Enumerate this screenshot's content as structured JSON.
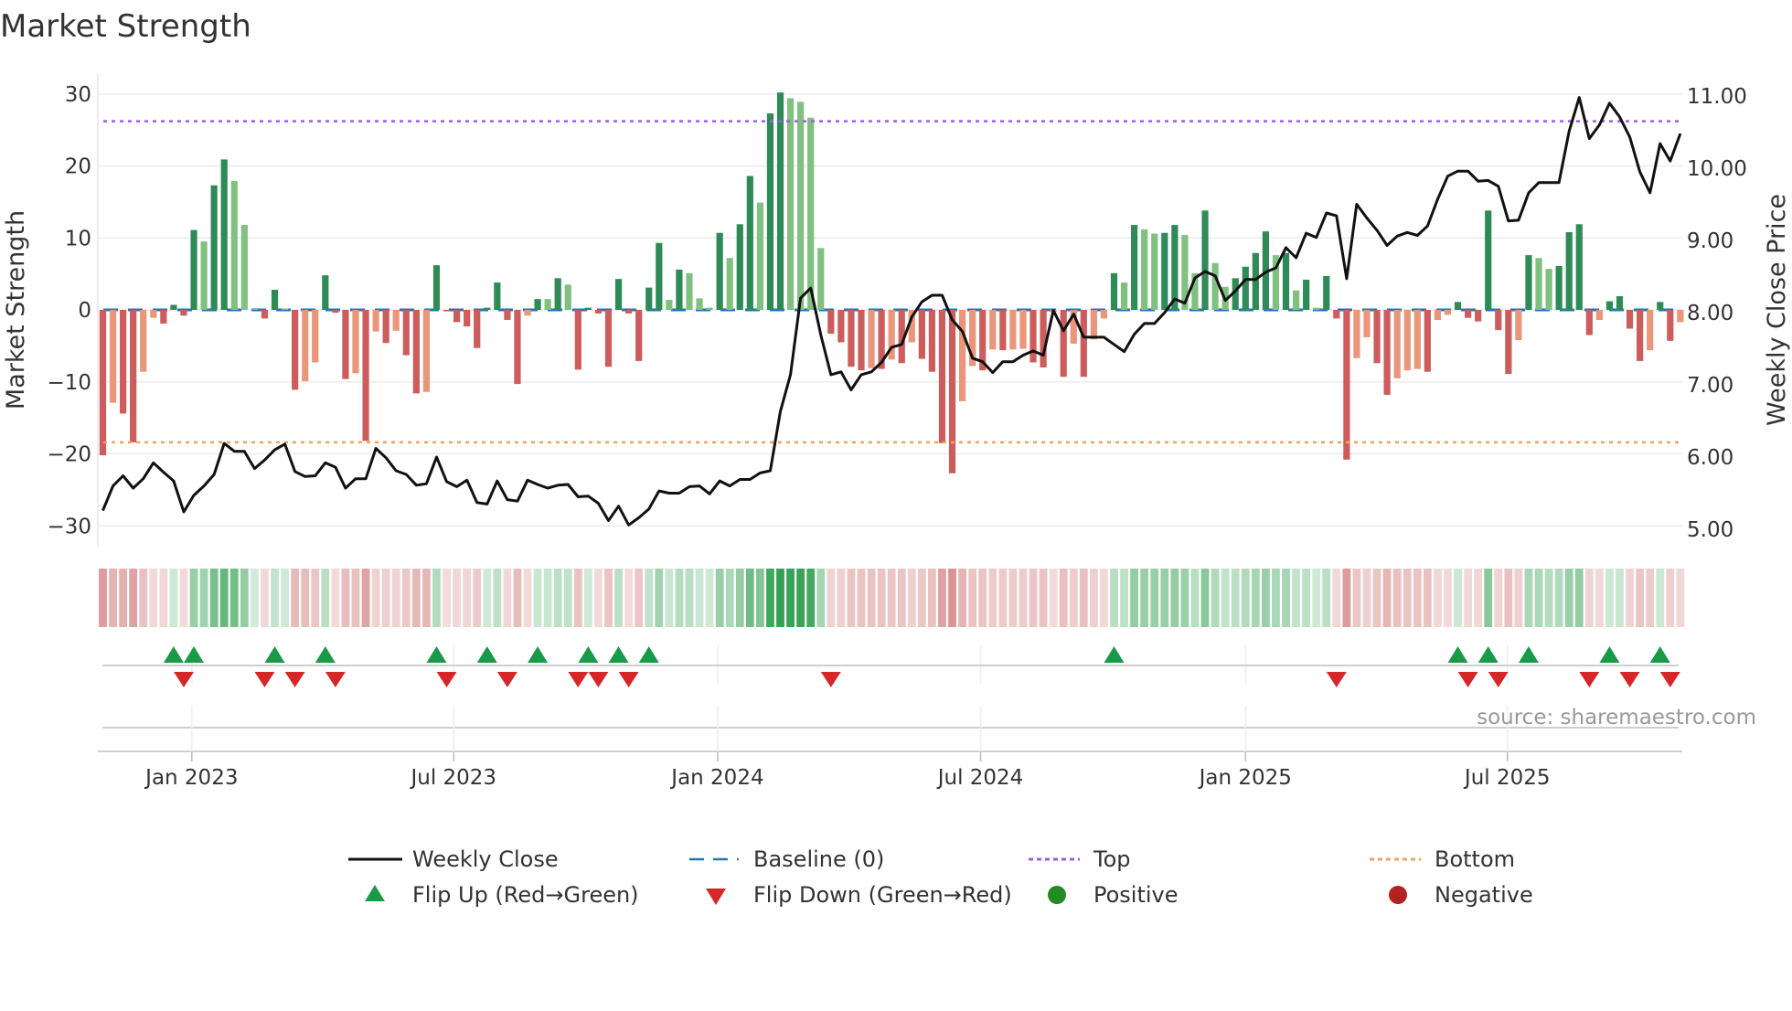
{
  "title": "Market Strength",
  "source": "source: sharemaestro.com",
  "colors": {
    "pos_strong": "#2e8b57",
    "pos_weak": "#80c080",
    "neg_strong": "#cd5c5c",
    "neg_weak": "#e9967a",
    "baseline": "#1f77b4",
    "top": "#9b5fdc",
    "bottom": "#f2a15f",
    "line": "#111111",
    "flip_up": "#1a9a48",
    "flip_down": "#d62728",
    "positive": "#228b22",
    "negative": "#b22222"
  },
  "chart_data": {
    "type": "bar",
    "title": "Market Strength",
    "ylabel": "Market Strength",
    "y2label": "Weekly Close Price",
    "ylim": [
      -33,
      33
    ],
    "y2lim": [
      4.8,
      11.2
    ],
    "yticks": [
      30,
      20,
      10,
      0,
      -10,
      -20,
      -30
    ],
    "ytick_labels": [
      "30",
      "20",
      "10",
      "0",
      "−10",
      "−20",
      "−30"
    ],
    "y2ticks": [
      11,
      10,
      9,
      8,
      7,
      6,
      5
    ],
    "y2tick_labels": [
      "11.00",
      "10.00",
      "9.00",
      "8.00",
      "7.00",
      "6.00",
      "5.00"
    ],
    "top_level": 26.2,
    "bottom_level": -18.4,
    "baseline": 0,
    "x_unit": "week index",
    "xticks": [
      {
        "label": "Jan 2023",
        "week": 8.8
      },
      {
        "label": "Jul 2023",
        "week": 34.7
      },
      {
        "label": "Jan 2024",
        "week": 60.8
      },
      {
        "label": "Jul 2024",
        "week": 86.8
      },
      {
        "label": "Jan 2025",
        "week": 113.0
      },
      {
        "label": "Jul 2025",
        "week": 138.9
      }
    ],
    "strength": [
      -20.2,
      -12.9,
      -14.4,
      -18.4,
      -8.6,
      -1.1,
      -1.9,
      0.7,
      -0.8,
      11.1,
      9.5,
      17.3,
      20.9,
      17.9,
      11.8,
      0.1,
      -1.2,
      2.8,
      0.2,
      -11.1,
      -9.9,
      -7.3,
      4.8,
      -0.4,
      -9.6,
      -8.8,
      -18.2,
      -3.0,
      -4.6,
      -2.9,
      -6.3,
      -11.6,
      -11.4,
      6.2,
      -0.2,
      -1.7,
      -2.3,
      -5.3,
      0.3,
      3.8,
      -1.4,
      -10.3,
      -0.8,
      1.5,
      1.5,
      4.4,
      3.5,
      -8.3,
      0.3,
      -0.5,
      -7.9,
      4.3,
      -0.5,
      -7.1,
      3.1,
      9.3,
      1.4,
      5.6,
      5.1,
      1.6,
      0.3,
      10.7,
      7.2,
      11.9,
      18.6,
      14.9,
      27.3,
      30.2,
      29.4,
      28.9,
      26.7,
      8.6,
      -3.3,
      -4.5,
      -7.9,
      -8.4,
      -8.1,
      -8.2,
      -6.9,
      -7.4,
      -4.5,
      -6.8,
      -8.6,
      -18.5,
      -22.7,
      -12.7,
      -7.8,
      -8.4,
      -5.5,
      -5.6,
      -5.5,
      -5.4,
      -7.3,
      -8.0,
      -0.3,
      -9.3,
      -4.7,
      -9.3,
      -4.1,
      -1.2,
      5.1,
      3.8,
      11.8,
      11.2,
      10.6,
      10.7,
      11.8,
      10.4,
      5.1,
      13.8,
      6.5,
      3.2,
      4.4,
      6.0,
      7.9,
      10.9,
      7.6,
      7.9,
      2.7,
      4.2,
      0.3,
      4.7,
      -1.2,
      -20.8,
      -6.7,
      -3.8,
      -7.4,
      -11.8,
      -9.5,
      -8.4,
      -8.2,
      -8.6,
      -1.4,
      -0.7,
      1.1,
      -1.1,
      -1.6,
      13.8,
      -2.8,
      -8.9,
      -4.2,
      7.6,
      7.2,
      5.7,
      6.1,
      10.8,
      11.9,
      -3.5,
      -1.4,
      1.2,
      1.9,
      -2.6,
      -7.1,
      -5.6,
      1.1,
      -4.3,
      -1.7
    ],
    "weekly_close": [
      5.26,
      5.6,
      5.74,
      5.57,
      5.7,
      5.92,
      5.79,
      5.67,
      5.24,
      5.47,
      5.6,
      5.76,
      6.19,
      6.08,
      6.08,
      5.84,
      5.96,
      6.1,
      6.18,
      5.8,
      5.73,
      5.74,
      5.92,
      5.86,
      5.57,
      5.7,
      5.7,
      6.12,
      5.99,
      5.81,
      5.76,
      5.61,
      5.63,
      6.0,
      5.66,
      5.59,
      5.68,
      5.37,
      5.35,
      5.67,
      5.41,
      5.39,
      5.68,
      5.62,
      5.57,
      5.61,
      5.62,
      5.45,
      5.46,
      5.36,
      5.12,
      5.32,
      5.06,
      5.16,
      5.28,
      5.53,
      5.5,
      5.5,
      5.59,
      5.6,
      5.49,
      5.67,
      5.6,
      5.69,
      5.69,
      5.78,
      5.81,
      6.63,
      7.14,
      8.2,
      8.34,
      7.69,
      7.14,
      7.18,
      6.93,
      7.14,
      7.18,
      7.31,
      7.52,
      7.56,
      7.94,
      8.15,
      8.24,
      8.24,
      7.9,
      7.74,
      7.37,
      7.32,
      7.17,
      7.32,
      7.32,
      7.41,
      7.47,
      7.41,
      8.03,
      7.75,
      7.98,
      7.66,
      7.66,
      7.66,
      7.56,
      7.46,
      7.7,
      7.85,
      7.85,
      8.0,
      8.19,
      8.13,
      8.48,
      8.57,
      8.51,
      8.17,
      8.3,
      8.46,
      8.46,
      8.56,
      8.62,
      8.9,
      8.76,
      9.1,
      9.04,
      9.38,
      9.34,
      8.47,
      9.5,
      9.31,
      9.14,
      8.93,
      9.06,
      9.11,
      9.07,
      9.2,
      9.57,
      9.89,
      9.96,
      9.96,
      9.82,
      9.83,
      9.75,
      9.27,
      9.28,
      9.66,
      9.8,
      9.8,
      9.8,
      10.51,
      10.98,
      10.41,
      10.6,
      10.9,
      10.71,
      10.43,
      9.95,
      9.66,
      10.34,
      10.1,
      10.48
    ],
    "legend": {
      "placement": "bottom",
      "items": [
        {
          "label": "Weekly Close"
        },
        {
          "label": "Baseline (0)"
        },
        {
          "label": "Top"
        },
        {
          "label": "Bottom"
        },
        {
          "label": "Flip Up (Red→Green)"
        },
        {
          "label": "Flip Down (Green→Red)"
        },
        {
          "label": "Positive"
        },
        {
          "label": "Negative"
        }
      ]
    }
  }
}
